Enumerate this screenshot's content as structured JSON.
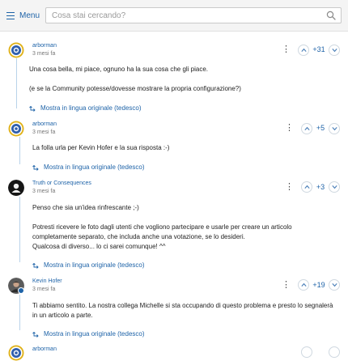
{
  "header": {
    "menu_label": "Menu",
    "search_placeholder": "Cosa stai cercando?"
  },
  "comments": [
    {
      "author": "arborman",
      "date": "3 mesi fa",
      "score": "+31",
      "lines": [
        "Una cosa bella, mi piace, ognuno ha la sua cosa che gli piace.",
        "(e se la Community potesse/dovesse mostrare la propria configurazione?)"
      ],
      "translate": "Mostra in lingua originale (tedesco)"
    },
    {
      "author": "arborman",
      "date": "3 mesi fa",
      "score": "+5",
      "lines": [
        "La folla urla per Kevin Hofer e la sua risposta :-)"
      ],
      "translate": "Mostra in lingua originale (tedesco)"
    },
    {
      "author": "Truth or Consequences",
      "date": "3 mesi fa",
      "score": "+3",
      "lines": [
        "Penso che sia un'idea rinfrescante ;-)",
        "Potresti ricevere le foto dagli utenti che vogliono partecipare e usarle per creare un articolo",
        "completamente separato, che includa anche una votazione, se lo desideri.",
        "Qualcosa di diverso... lo ci sarei comunque! ^^"
      ],
      "translate": "Mostra in lingua originale (tedesco)"
    },
    {
      "author": "Kevin Hofer",
      "date": "3 mesi fa",
      "score": "+19",
      "lines": [
        "Ti abbiamo sentito. La nostra collega Michelle si sta occupando di questo problema e presto lo segnalerà",
        "in un articolo a parte."
      ],
      "translate": "Mostra in lingua originale (tedesco)"
    },
    {
      "author": "arborman"
    }
  ],
  "colors": {
    "accent": "#1e63a8",
    "thread_line": "#b9d3ea",
    "avatar_ring": "#e0b21a"
  }
}
